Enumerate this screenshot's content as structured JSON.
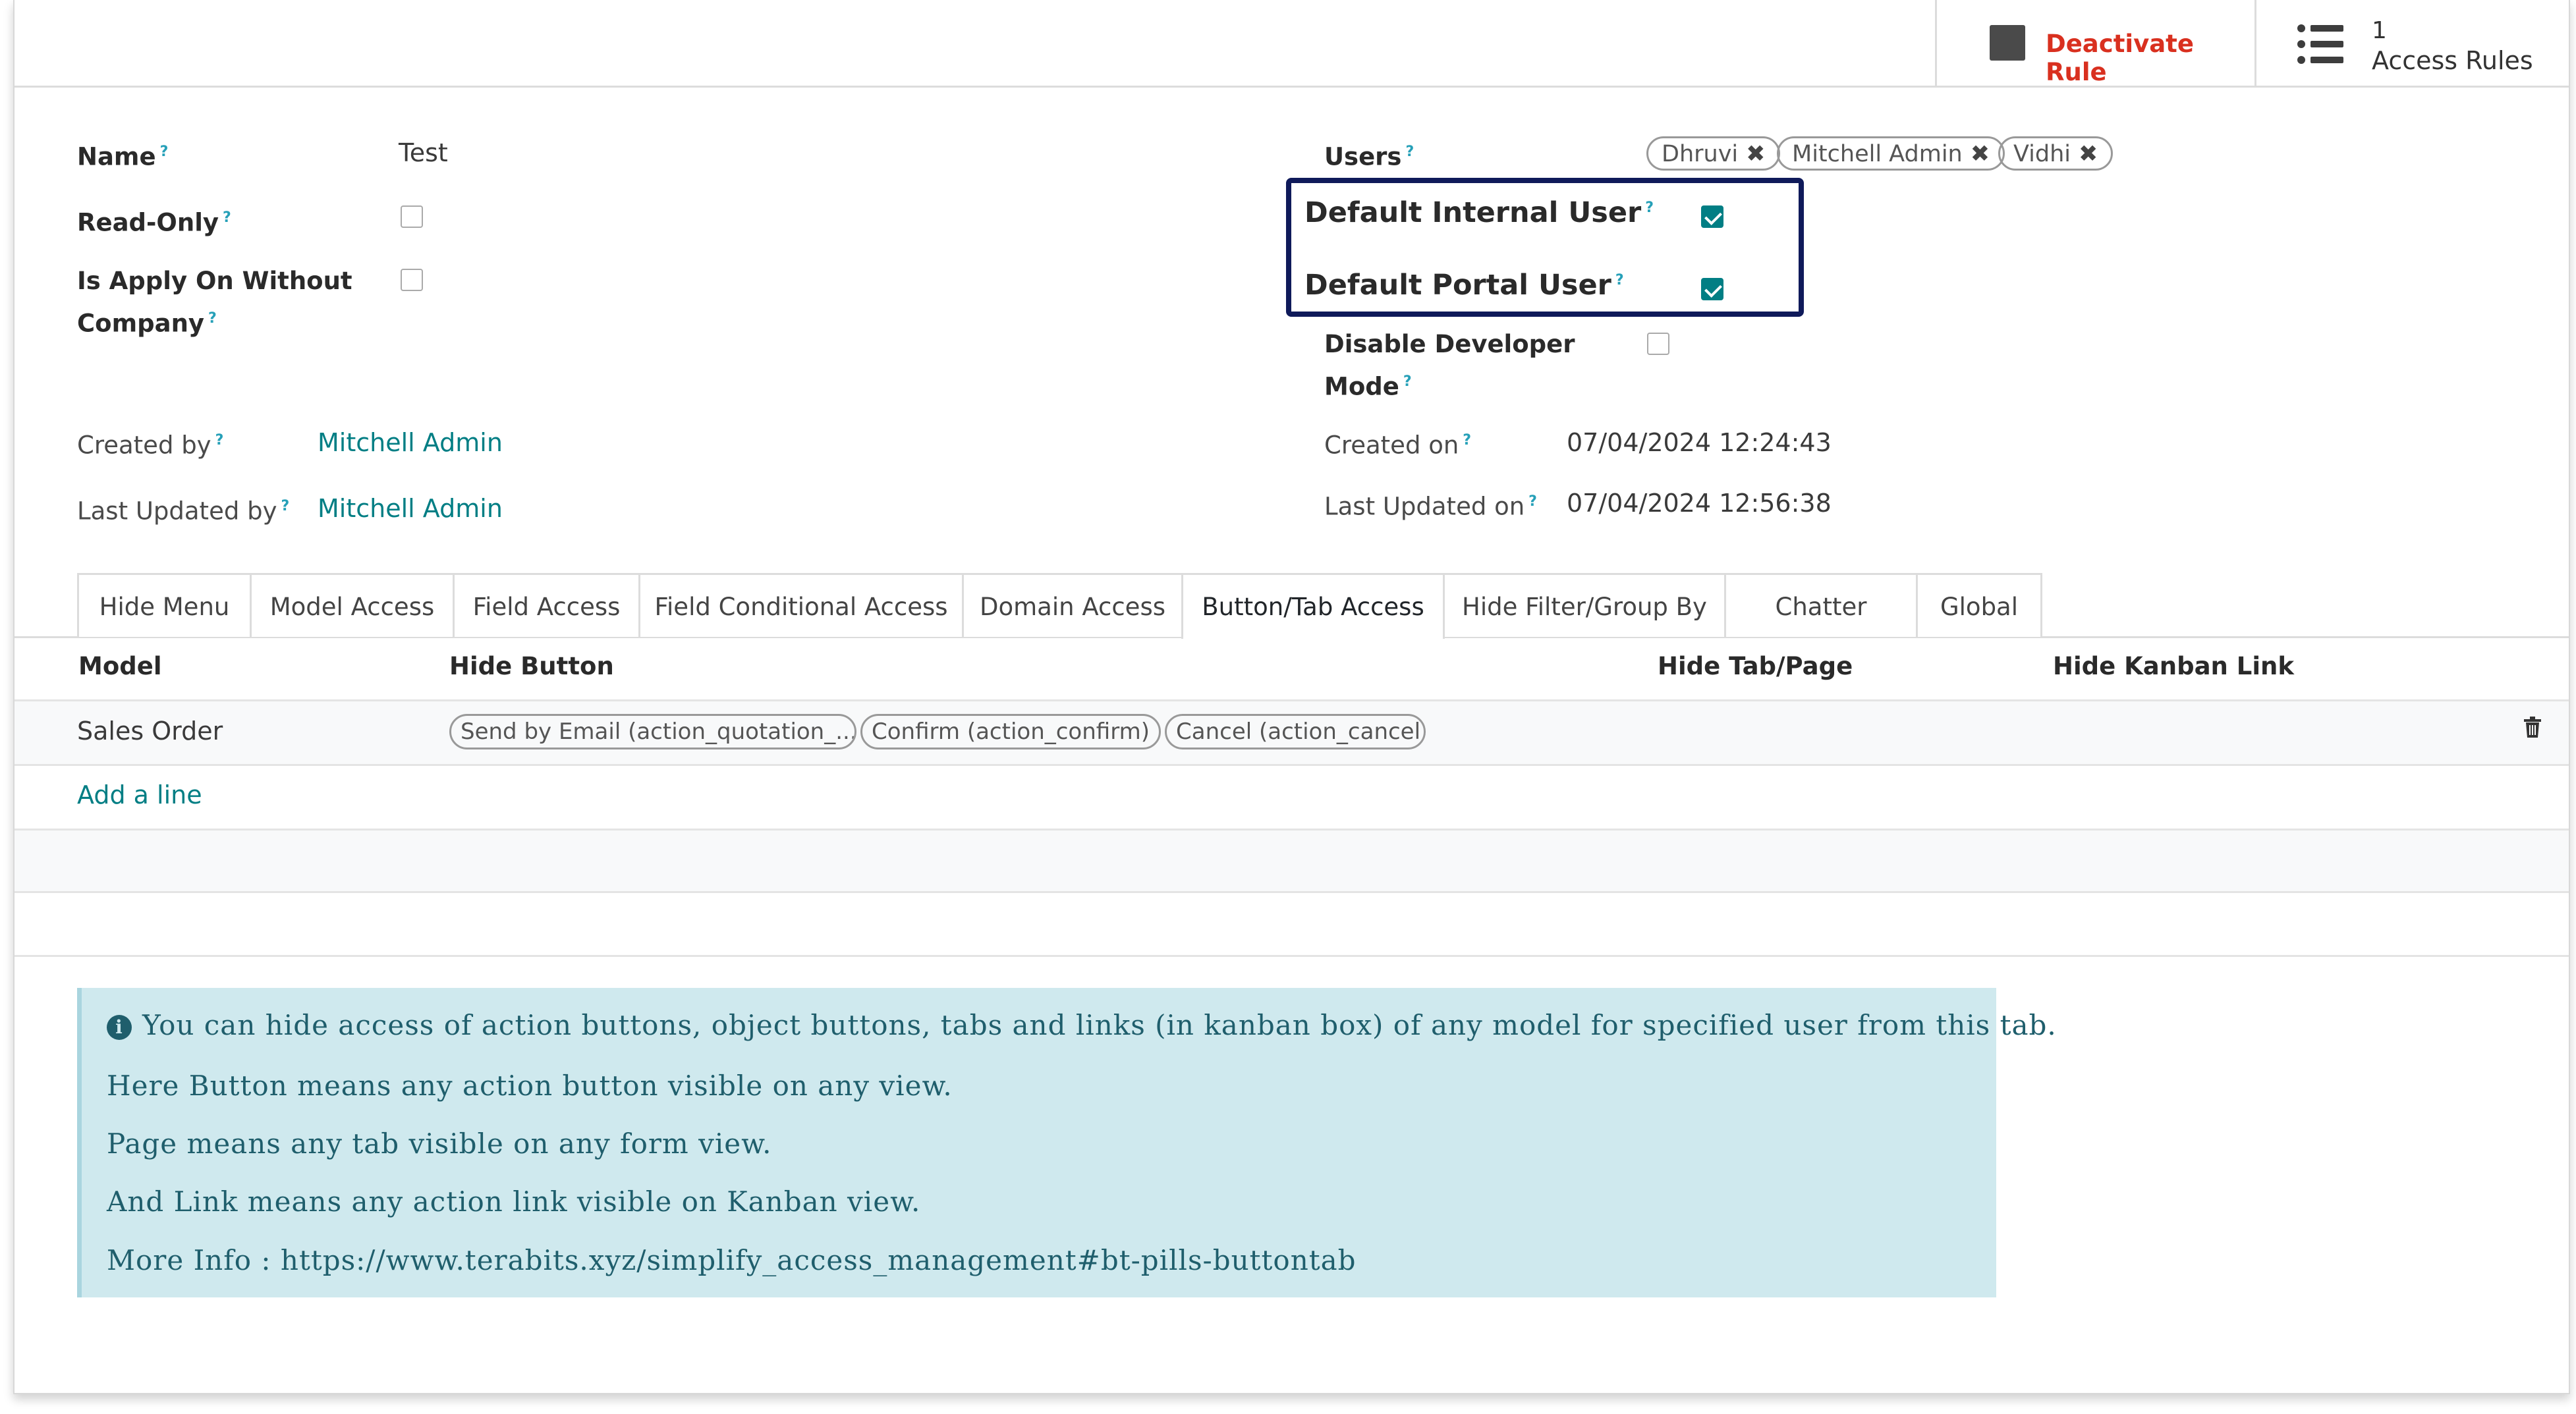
{
  "buttons": {
    "deactivate_label": "Deactivate Rule",
    "access_rules_count": "1",
    "access_rules_label": "Access Rules"
  },
  "form": {
    "name_label": "Name",
    "name_value": "Test",
    "readonly_label": "Read-Only",
    "apply_without_company_label_line1": "Is Apply On Without",
    "apply_without_company_label_line2": "Company",
    "users_label": "Users",
    "users": [
      "Dhruvi",
      "Mitchell Admin",
      "Vidhi"
    ],
    "default_internal_user_label": "Default Internal User",
    "default_portal_user_label": "Default Portal User",
    "disable_dev_mode_label_line1": "Disable Developer",
    "disable_dev_mode_label_line2": "Mode",
    "created_by_label": "Created by",
    "created_by_value": "Mitchell Admin",
    "last_updated_by_label": "Last Updated by",
    "last_updated_by_value": "Mitchell Admin",
    "created_on_label": "Created on",
    "created_on_value": "07/04/2024 12:24:43",
    "last_updated_on_label": "Last Updated on",
    "last_updated_on_value": "07/04/2024 12:56:38",
    "readonly_checked": false,
    "apply_without_company_checked": false,
    "default_internal_user_checked": true,
    "default_portal_user_checked": true,
    "disable_dev_mode_checked": false
  },
  "tabs": [
    "Hide Menu",
    "Model Access",
    "Field Access",
    "Field Conditional Access",
    "Domain Access",
    "Button/Tab Access",
    "Hide Filter/Group By",
    "Chatter",
    "Global"
  ],
  "active_tab": "Button/Tab Access",
  "table": {
    "headers": [
      "Model",
      "Hide Button",
      "Hide Tab/Page",
      "Hide Kanban Link"
    ],
    "rows": [
      {
        "model": "Sales Order",
        "buttons": [
          "Send by Email (action_quotation_...",
          "Confirm (action_confirm)",
          "Cancel (action_cancel)"
        ]
      }
    ],
    "add_line": "Add a line"
  },
  "alert": {
    "line1": "You can hide access of action buttons, object buttons, tabs and links (in kanban box) of any model for specified user from this tab.",
    "line2": "Here Button means any action button visible on any view.",
    "line3": "Page means any tab visible on any form view.",
    "line4": "And Link means any action link visible on Kanban view.",
    "line5": "More Info : https://www.terabits.xyz/simplify_access_management#bt-pills-buttontab"
  },
  "colors": {
    "accent": "#017e84",
    "danger": "#d9301f",
    "highlight_border": "#0f1a5a",
    "alert_bg": "#cfe9ee"
  }
}
